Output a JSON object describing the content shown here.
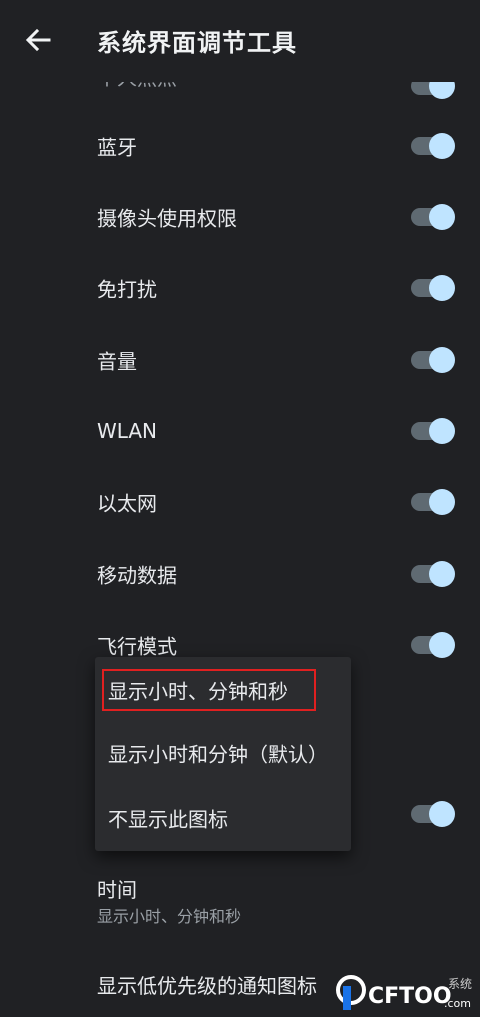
{
  "header": {
    "title": "系统界面调节工具",
    "back_icon": "arrow-left-icon"
  },
  "clipped_item": "个人热点",
  "toggles": [
    {
      "label": "蓝牙",
      "on": true
    },
    {
      "label": "摄像头使用权限",
      "on": true
    },
    {
      "label": "免打扰",
      "on": true
    },
    {
      "label": "音量",
      "on": true
    },
    {
      "label": "WLAN",
      "on": true
    },
    {
      "label": "以太网",
      "on": true
    },
    {
      "label": "移动数据",
      "on": true
    },
    {
      "label": "飞行模式",
      "on": true
    }
  ],
  "menu": {
    "items": [
      "显示小时、分钟和秒",
      "显示小时和分钟（默认）",
      "不显示此图标"
    ],
    "highlighted": "显示小时、分钟和秒"
  },
  "time": {
    "title": "时间",
    "summary": "显示小时、分钟和秒"
  },
  "low_priority": {
    "label": "显示低优先级的通知图标"
  },
  "watermark": {
    "text": "CFTOO",
    "suffix": ".com",
    "tag": "系统"
  },
  "colors": {
    "background": "#202124",
    "switch_thumb": "#bfe4ff",
    "switch_track": "#5f6a72",
    "highlight": "#e02020"
  }
}
